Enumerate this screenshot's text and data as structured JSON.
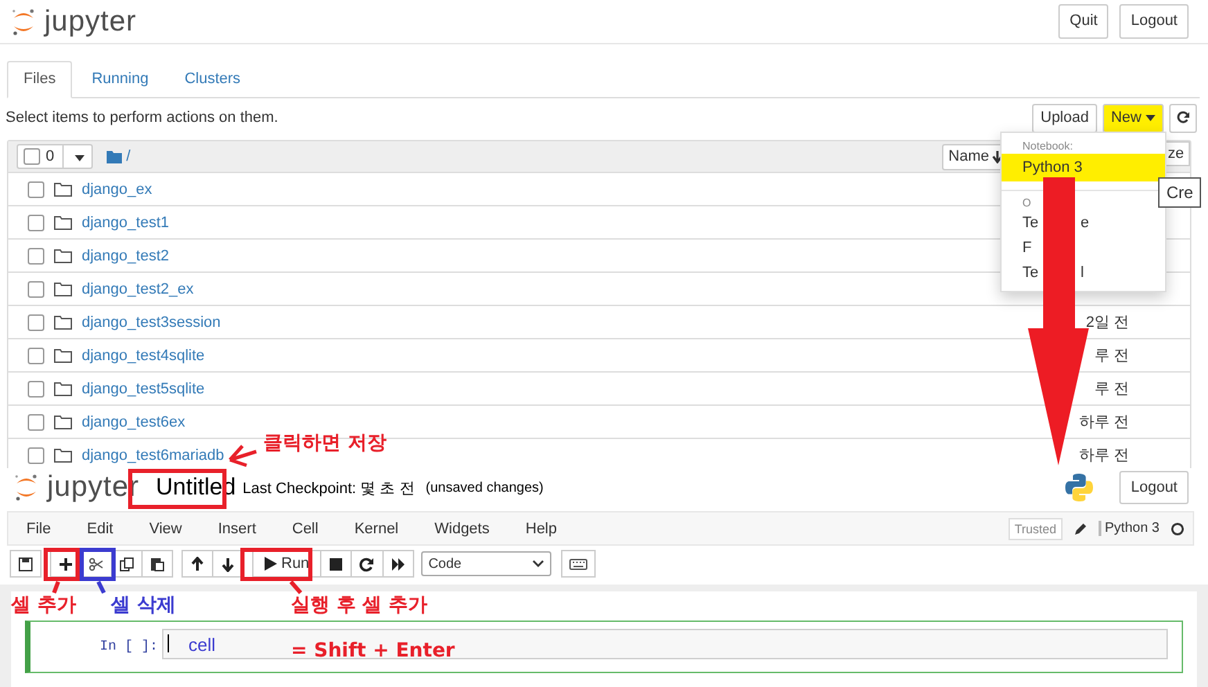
{
  "dashboard": {
    "logo": "jupyter",
    "header_buttons": [
      "Quit",
      "Logout"
    ],
    "tabs": [
      {
        "label": "Files",
        "selected": true
      },
      {
        "label": "Running",
        "selected": false
      },
      {
        "label": "Clusters",
        "selected": false
      }
    ],
    "hint": "Select items to perform actions on them.",
    "upload": "Upload",
    "new": {
      "label": "New",
      "highlighted": true
    },
    "list_header": {
      "checked": false,
      "count": "0",
      "path": "/",
      "sort": "Name",
      "column_2": "ze"
    },
    "rows": [
      {
        "name": "django_ex",
        "checked": false
      },
      {
        "name": "django_test1",
        "checked": false
      },
      {
        "name": "django_test2",
        "checked": false
      },
      {
        "name": "django_test2_ex",
        "checked": false
      },
      {
        "name": "django_test3session",
        "checked": false,
        "modified": "2일 전"
      },
      {
        "name": "django_test4sqlite",
        "checked": false,
        "modified": "루 전"
      },
      {
        "name": "django_test5sqlite",
        "checked": false,
        "modified": "루 전"
      },
      {
        "name": "django_test6ex",
        "checked": false,
        "modified": "하루 전"
      },
      {
        "name": "django_test6mariadb",
        "checked": false,
        "modified": "하루 전"
      }
    ],
    "new_menu": {
      "section_1": "Notebook:",
      "items": [
        {
          "label": "Python 3",
          "highlighted": true
        }
      ],
      "section_2": "O",
      "other_items": [
        [
          "Te",
          "e"
        ],
        [
          "F"
        ],
        [
          "Te",
          "l"
        ]
      ]
    },
    "tooltip": "Cre"
  },
  "notebook": {
    "logo": "jupyter",
    "title": "Untitled",
    "checkpoint": "Last Checkpoint: 몇 초 전",
    "status": "(unsaved changes)",
    "logout": "Logout",
    "menu": [
      "File",
      "Edit",
      "View",
      "Insert",
      "Cell",
      "Kernel",
      "Widgets",
      "Help"
    ],
    "trusted": "Trusted",
    "kernel": "Python 3",
    "run": "Run",
    "cell_type": "Code",
    "cell": {
      "prompt": "In [ ]:",
      "code": "cell"
    }
  },
  "annotations": [
    {
      "text": "클릭하면 저장",
      "color": "#e8202a"
    },
    {
      "text": "셀 추가",
      "color": "#e8202a"
    },
    {
      "text": "셀 삭제",
      "color": "#3b3bd0"
    },
    {
      "text": "실행 후 셀 추가",
      "color": "#e8202a"
    },
    {
      "text": "= Shift + Enter",
      "color": "#e8202a"
    }
  ]
}
